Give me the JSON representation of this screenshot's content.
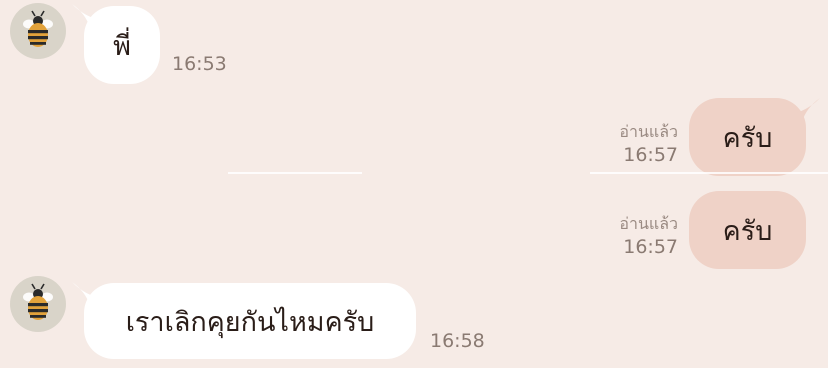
{
  "chat": {
    "messages": [
      {
        "direction": "incoming",
        "text": "พี่",
        "time": "16:53",
        "sender_avatar": "bee-avatar-icon"
      },
      {
        "direction": "outgoing",
        "text": "ครับ",
        "status": "อ่านแล้ว",
        "time": "16:57"
      },
      {
        "direction": "outgoing",
        "text": "ครับ",
        "status": "อ่านแล้ว",
        "time": "16:57"
      },
      {
        "direction": "incoming",
        "text": "เราเลิกคุยกันไหมครับ",
        "time": "16:58",
        "sender_avatar": "bee-avatar-icon"
      }
    ]
  },
  "colors": {
    "background": "#f6ebe6",
    "incoming_bubble": "#ffffff",
    "outgoing_bubble": "#efd2c7",
    "avatar_background": "#d9d4c9"
  }
}
